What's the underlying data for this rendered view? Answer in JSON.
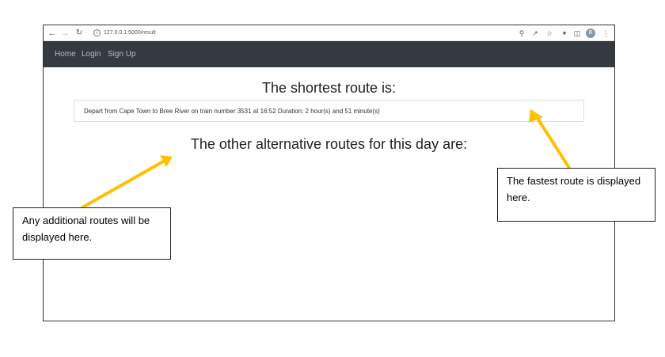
{
  "browser": {
    "url": "127.0.0.1:5000/result",
    "toolbar_icons": [
      "back-icon",
      "forward-icon",
      "reload-icon",
      "info-icon",
      "zoom-icon",
      "share-icon",
      "star-icon",
      "extensions-icon",
      "sidebar-icon",
      "profile-avatar",
      "menu-icon"
    ],
    "profile_initial": "B"
  },
  "navbar": {
    "home": "Home",
    "login": "Login",
    "signup": "Sign Up"
  },
  "main": {
    "shortest_heading": "The shortest route is:",
    "route_text": "Depart from Cape Town to Bree River on train number 3531 at 16:52 Duration: 2 hour(s) and 51 minute(s)",
    "other_heading": "The other alternative routes for this day are:"
  },
  "annotations": {
    "fastest": "The fastest route is displayed here.",
    "additional": "Any additional routes will be displayed here.",
    "arrow_color": "#FFC000"
  }
}
